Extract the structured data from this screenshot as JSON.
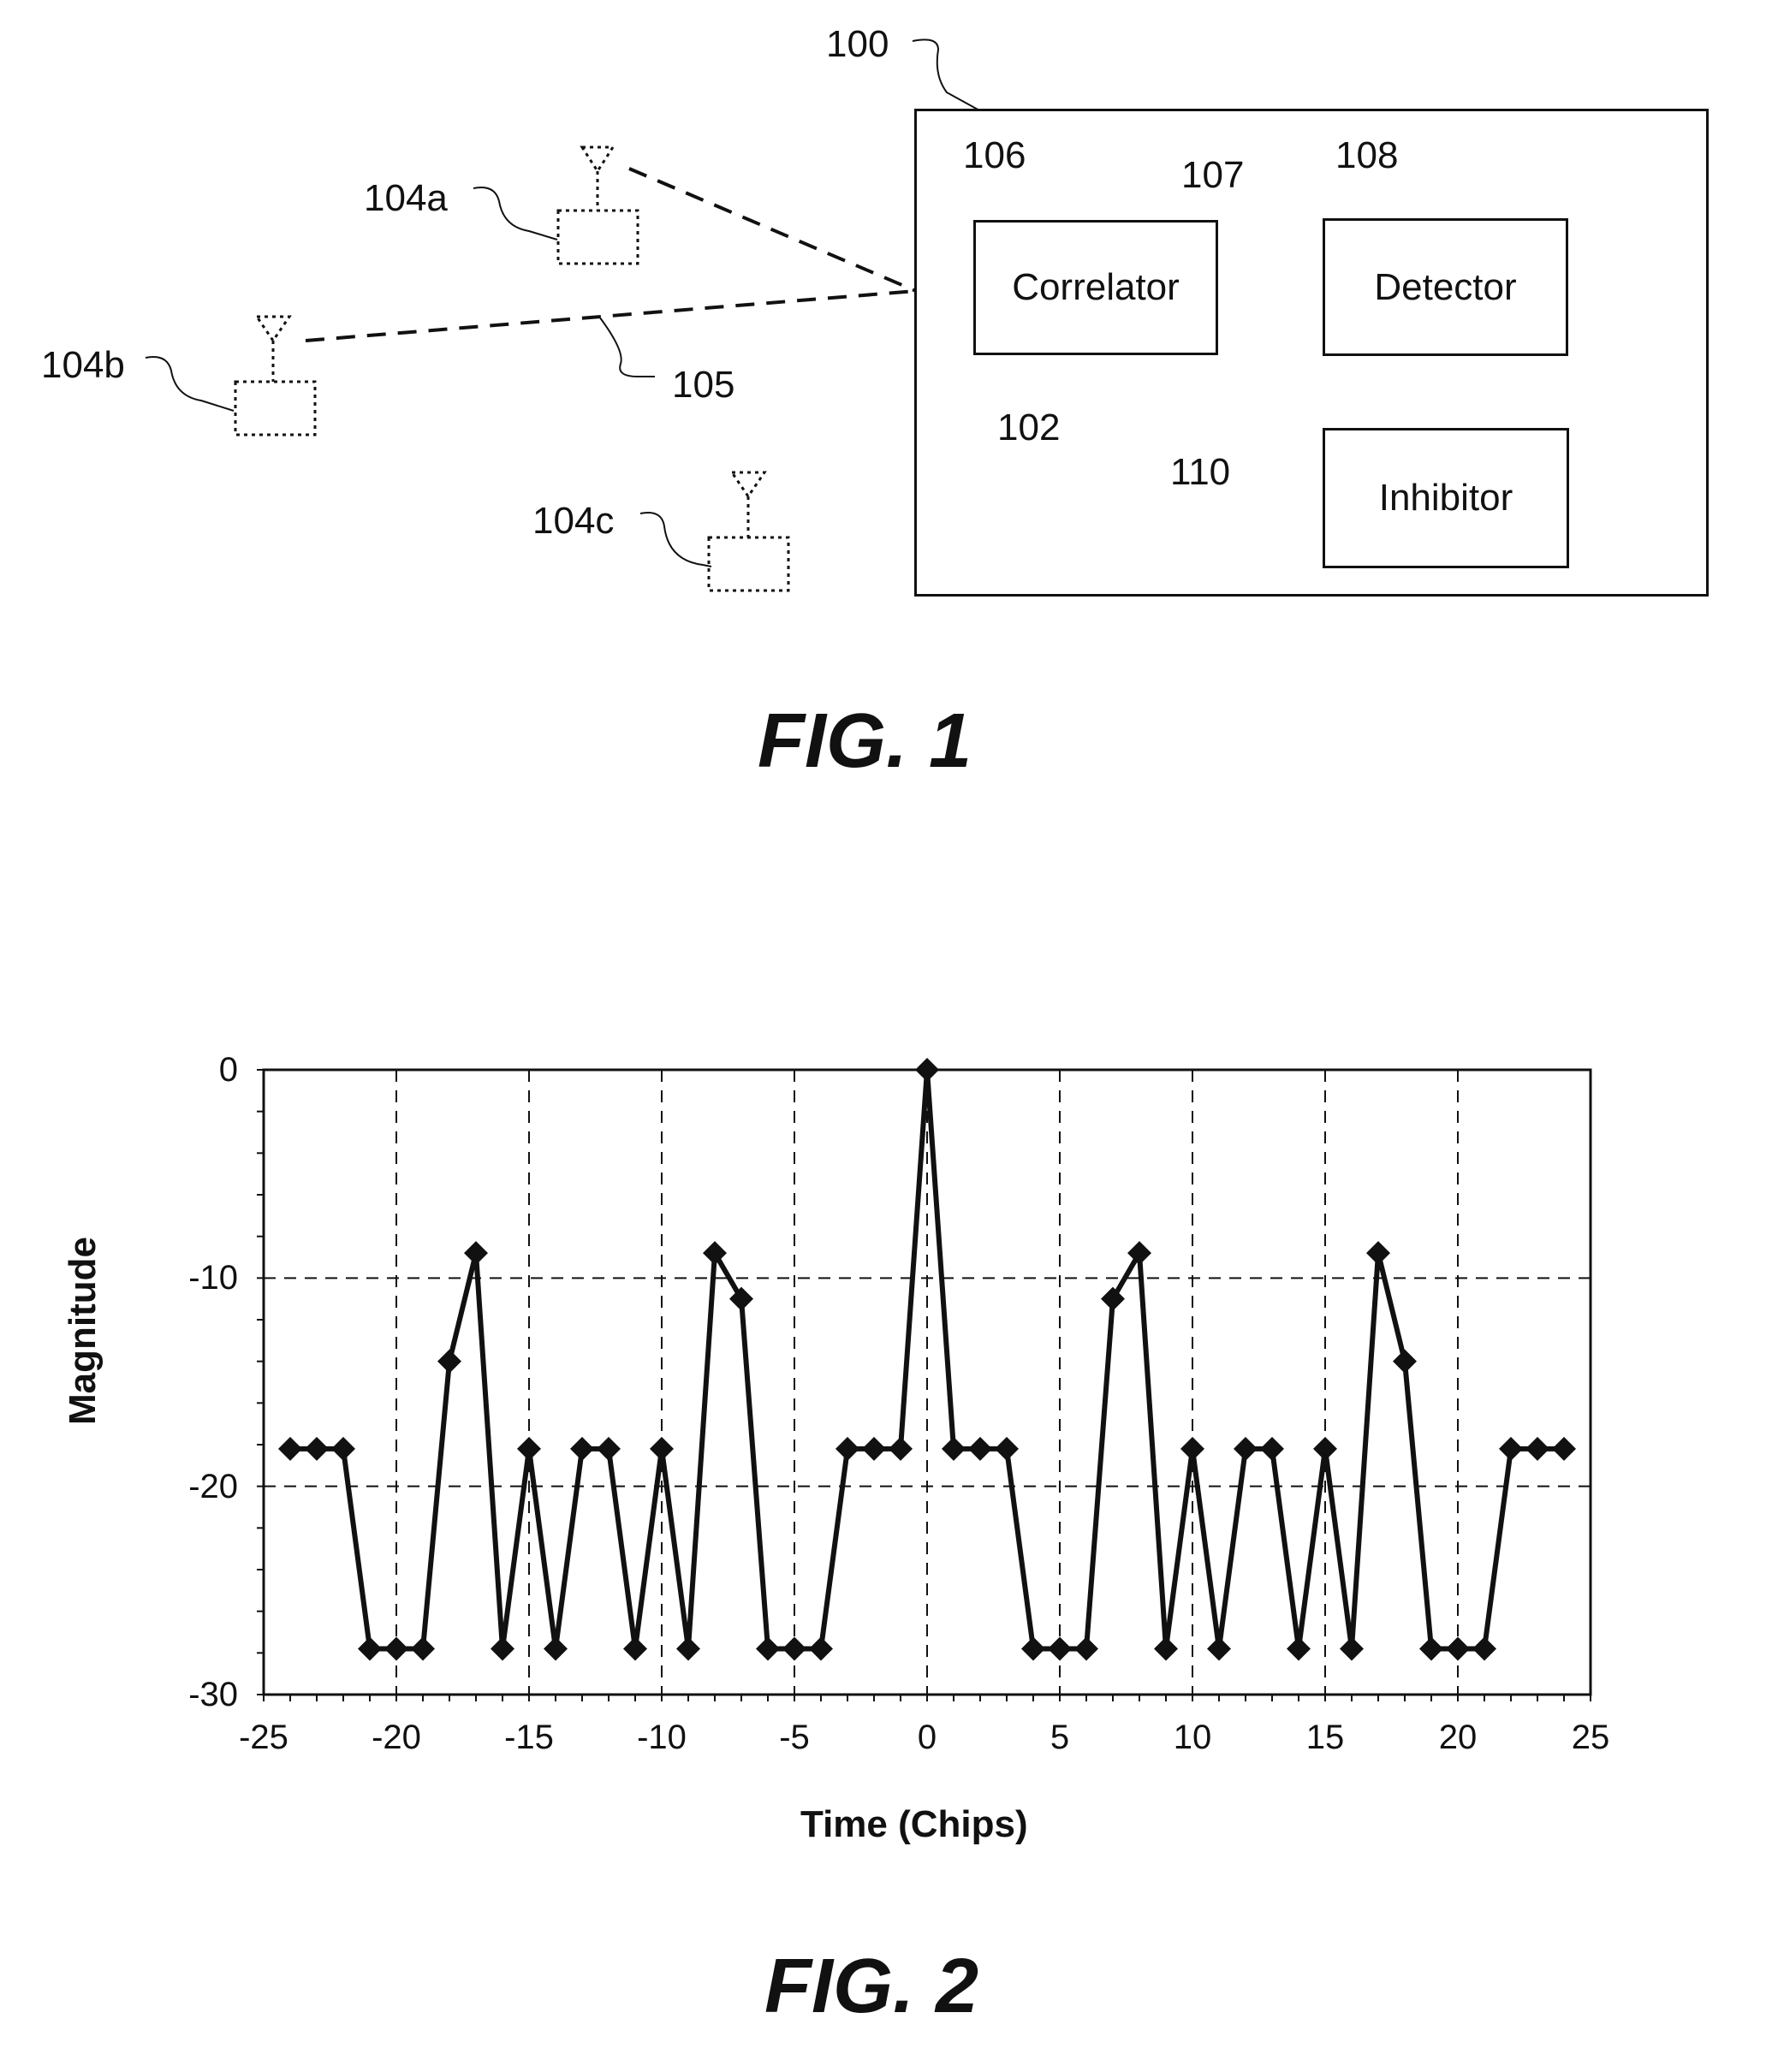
{
  "fig1": {
    "caption": "FIG. 1",
    "system_label": "100",
    "antenna_input_label": "102",
    "transmitters": [
      {
        "label": "104a"
      },
      {
        "label": "104b"
      },
      {
        "label": "104c"
      }
    ],
    "signal_label": "105",
    "blocks": {
      "correlator": {
        "ref": "106",
        "label": "Correlator"
      },
      "detector": {
        "ref": "108",
        "label": "Detector"
      },
      "inhibitor": {
        "ref": "110",
        "label": "Inhibitor"
      }
    },
    "correlator_output_label": "107"
  },
  "fig2": {
    "caption": "FIG. 2"
  },
  "chart_data": {
    "type": "line",
    "title": "",
    "xlabel": "Time (Chips)",
    "ylabel": "Magnitude",
    "xlim": [
      -25,
      25
    ],
    "ylim": [
      -30,
      0
    ],
    "xticks": [
      -25,
      -20,
      -15,
      -10,
      -5,
      0,
      5,
      10,
      15,
      20,
      25
    ],
    "yticks": [
      0,
      -10,
      -20,
      -30
    ],
    "grid": true,
    "marker": "diamond",
    "x": [
      -24,
      -23,
      -22,
      -21,
      -20,
      -19,
      -18,
      -17,
      -16,
      -15,
      -14,
      -13,
      -12,
      -11,
      -10,
      -9,
      -8,
      -7,
      -6,
      -5,
      -4,
      -3,
      -2,
      -1,
      0,
      1,
      2,
      3,
      4,
      5,
      6,
      7,
      8,
      9,
      10,
      11,
      12,
      13,
      14,
      15,
      16,
      17,
      18,
      19,
      20,
      21,
      22,
      23,
      24
    ],
    "y": [
      -18.2,
      -18.2,
      -18.2,
      -27.8,
      -27.8,
      -27.8,
      -14,
      -8.8,
      -27.8,
      -18.2,
      -27.8,
      -18.2,
      -18.2,
      -27.8,
      -18.2,
      -27.8,
      -8.8,
      -11,
      -27.8,
      -27.8,
      -27.8,
      -18.2,
      -18.2,
      -18.2,
      0,
      -18.2,
      -18.2,
      -18.2,
      -27.8,
      -27.8,
      -27.8,
      -11,
      -8.8,
      -27.8,
      -18.2,
      -27.8,
      -18.2,
      -18.2,
      -27.8,
      -18.2,
      -27.8,
      -8.8,
      -14,
      -27.8,
      -27.8,
      -27.8,
      -18.2,
      -18.2,
      -18.2
    ]
  }
}
